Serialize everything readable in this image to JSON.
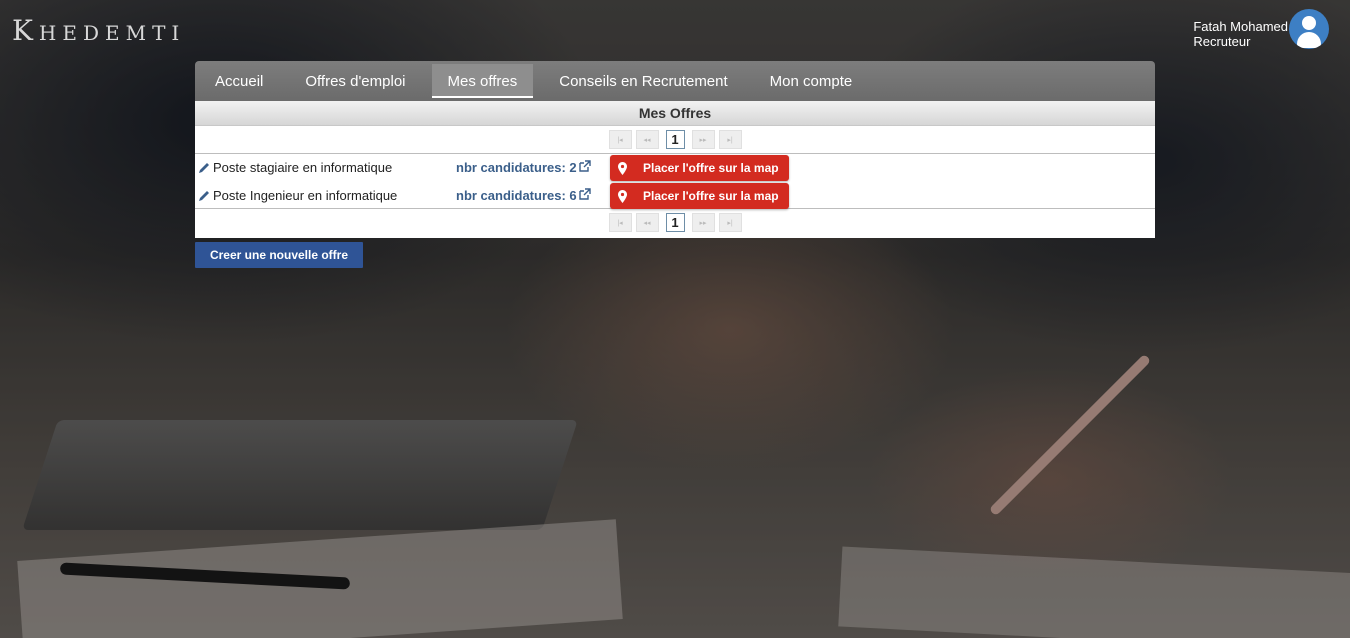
{
  "brand": {
    "logo_first": "K",
    "logo_rest": "HEDEMTI"
  },
  "user": {
    "name": "Fatah Mohamed",
    "role": "Recruteur",
    "avatar_icon": "user-avatar-icon"
  },
  "nav": {
    "items": [
      {
        "label": "Accueil",
        "active": false
      },
      {
        "label": "Offres d'emploi",
        "active": false
      },
      {
        "label": "Mes offres",
        "active": true
      },
      {
        "label": "Conseils en Recrutement",
        "active": false
      },
      {
        "label": "Mon compte",
        "active": false
      }
    ]
  },
  "panel": {
    "title": "Mes Offres",
    "paginator": {
      "first": "|◂",
      "prev": "◂◂",
      "page": "1",
      "next": "▸▸",
      "last": "▸|"
    },
    "offers": [
      {
        "title": "Poste stagiaire en informatique",
        "candidatures": "nbr candidatures: 2",
        "map_label": "Placer l'offre sur la map"
      },
      {
        "title": "Poste Ingenieur en informatique",
        "candidatures": "nbr candidatures: 6",
        "map_label": "Placer l'offre sur la map"
      }
    ]
  },
  "actions": {
    "new_offer_label": "Creer une nouvelle offre"
  },
  "colors": {
    "accent_red": "#d32b20",
    "primary_blue": "#2f5496",
    "link_blue": "#3b5f8a",
    "nav_gray": "#757575"
  }
}
